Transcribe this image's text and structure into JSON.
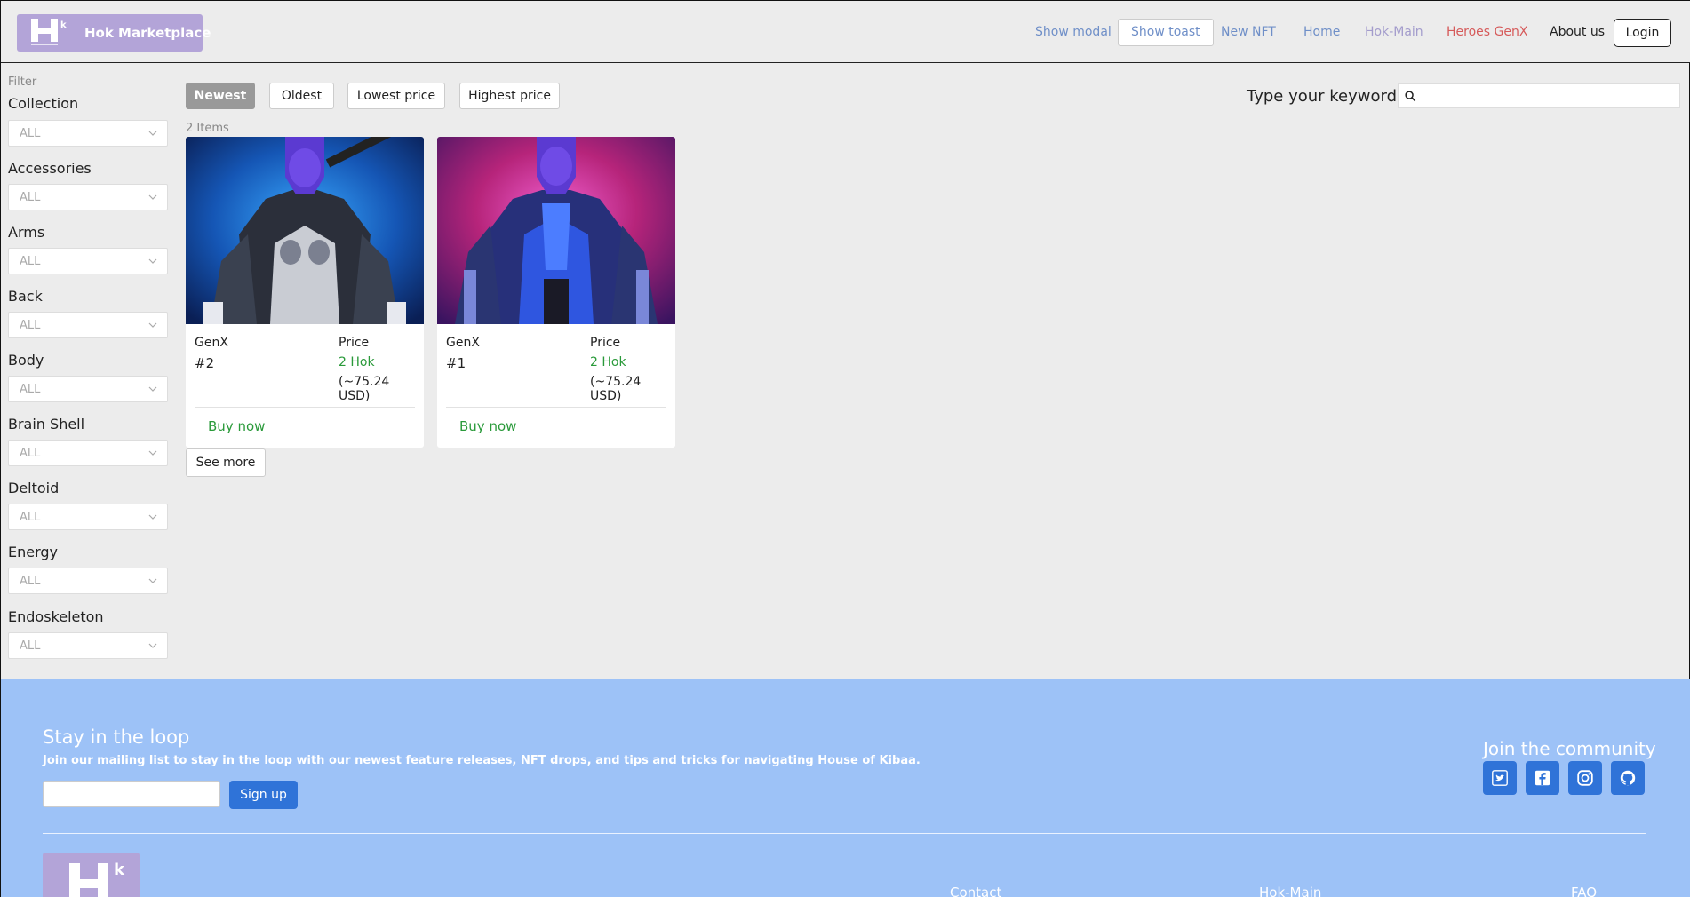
{
  "header": {
    "brand_name": "Hok Marketplace",
    "nav": {
      "show_modal": "Show modal",
      "show_toast": "Show toast",
      "new_nft": "New NFT",
      "home": "Home",
      "hok_main": "Hok-Main",
      "heroes_genx": "Heroes GenX",
      "about_us": "About us",
      "login": "Login"
    }
  },
  "sidebar": {
    "title": "Filter",
    "filters": [
      {
        "label": "Collection",
        "value": "ALL"
      },
      {
        "label": "Accessories",
        "value": "ALL"
      },
      {
        "label": "Arms",
        "value": "ALL"
      },
      {
        "label": "Back",
        "value": "ALL"
      },
      {
        "label": "Body",
        "value": "ALL"
      },
      {
        "label": "Brain Shell",
        "value": "ALL"
      },
      {
        "label": "Deltoid",
        "value": "ALL"
      },
      {
        "label": "Energy",
        "value": "ALL"
      },
      {
        "label": "Endoskeleton",
        "value": "ALL"
      }
    ]
  },
  "sort": {
    "newest": "Newest",
    "oldest": "Oldest",
    "lowest_price": "Lowest price",
    "highest_price": "Highest price",
    "active": "Newest"
  },
  "search": {
    "label": "Type your keyword",
    "value": ""
  },
  "results": {
    "count_text": "2 Items",
    "see_more": "See more",
    "items": [
      {
        "collection": "GenX",
        "id": "#2",
        "price_label": "Price",
        "price": "2 Hok",
        "usd": "(~75.24 USD)",
        "buy": "Buy now"
      },
      {
        "collection": "GenX",
        "id": "#1",
        "price_label": "Price",
        "price": "2 Hok",
        "usd": "(~75.24 USD)",
        "buy": "Buy now"
      }
    ]
  },
  "footer": {
    "title": "Stay in the loop",
    "description": "Join our mailing list to stay in the loop with our newest feature releases, NFT drops, and tips and tricks for navigating House of Kibaa.",
    "email_value": "",
    "signup": "Sign up",
    "community_title": "Join the community",
    "social": [
      "twitter-icon",
      "facebook-icon",
      "instagram-icon",
      "github-icon"
    ],
    "links": {
      "contact": "Contact",
      "hok_main": "Hok-Main",
      "faq": "FAQ"
    }
  },
  "colors": {
    "brand": "#b3a4d8",
    "footer_bg": "#9dc2f7",
    "accent_blue": "#2f73d8",
    "price_green": "#2a9a3a",
    "heroes_red": "#d65a5a"
  }
}
